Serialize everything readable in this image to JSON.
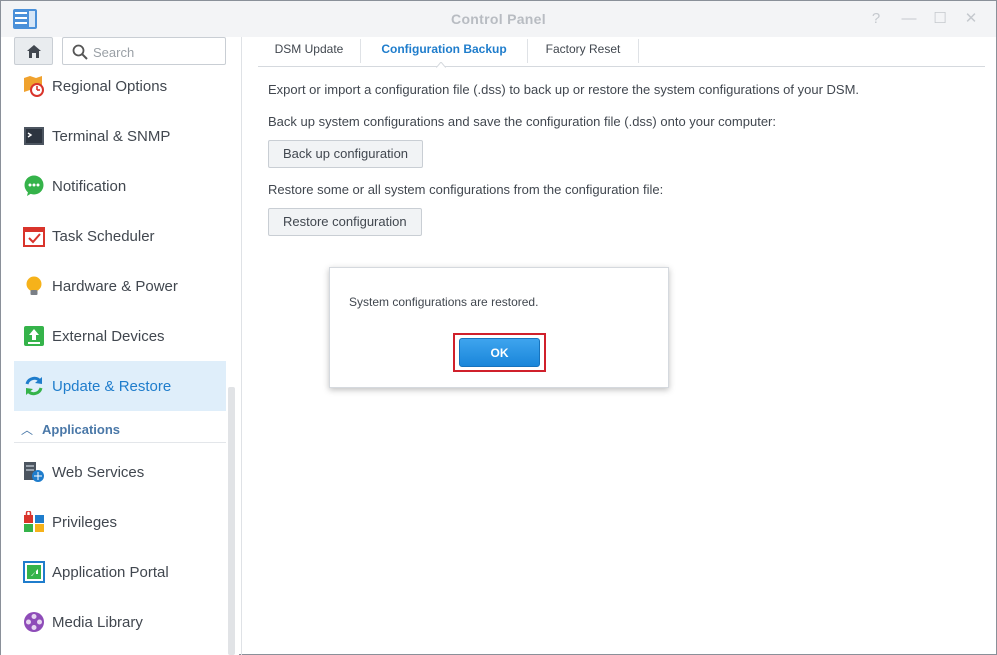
{
  "window": {
    "title": "Control Panel",
    "controls": {
      "help": "?",
      "minimize": "—",
      "maximize": "☐",
      "close": "✕"
    }
  },
  "sidebar": {
    "search_placeholder": "Search",
    "items": [
      {
        "label": "Regional Options",
        "icon": "regional-options-icon"
      },
      {
        "label": "Terminal & SNMP",
        "icon": "terminal-icon"
      },
      {
        "label": "Notification",
        "icon": "notification-icon"
      },
      {
        "label": "Task Scheduler",
        "icon": "task-scheduler-icon"
      },
      {
        "label": "Hardware & Power",
        "icon": "lightbulb-icon"
      },
      {
        "label": "External Devices",
        "icon": "external-devices-icon"
      },
      {
        "label": "Update & Restore",
        "icon": "update-restore-icon",
        "active": true
      }
    ],
    "section": {
      "label": "Applications"
    },
    "app_items": [
      {
        "label": "Web Services",
        "icon": "web-services-icon"
      },
      {
        "label": "Privileges",
        "icon": "privileges-icon"
      },
      {
        "label": "Application Portal",
        "icon": "application-portal-icon"
      },
      {
        "label": "Media Library",
        "icon": "media-library-icon"
      }
    ]
  },
  "tabs": [
    {
      "label": "DSM Update"
    },
    {
      "label": "Configuration Backup",
      "active": true
    },
    {
      "label": "Factory Reset"
    }
  ],
  "content": {
    "intro": "Export or import a configuration file (.dss) to back up or restore the system configurations of your DSM.",
    "backup_desc": "Back up system configurations and save the configuration file (.dss) onto your computer:",
    "backup_button": "Back up configuration",
    "restore_desc": "Restore some or all system configurations from the configuration file:",
    "restore_button": "Restore configuration"
  },
  "dialog": {
    "message": "System configurations are restored.",
    "ok_label": "OK"
  },
  "colors": {
    "accent": "#1f7dcc",
    "active_bg": "#dfeefa",
    "ok_button": "#2a93e3",
    "highlight_border": "#d0202b"
  }
}
